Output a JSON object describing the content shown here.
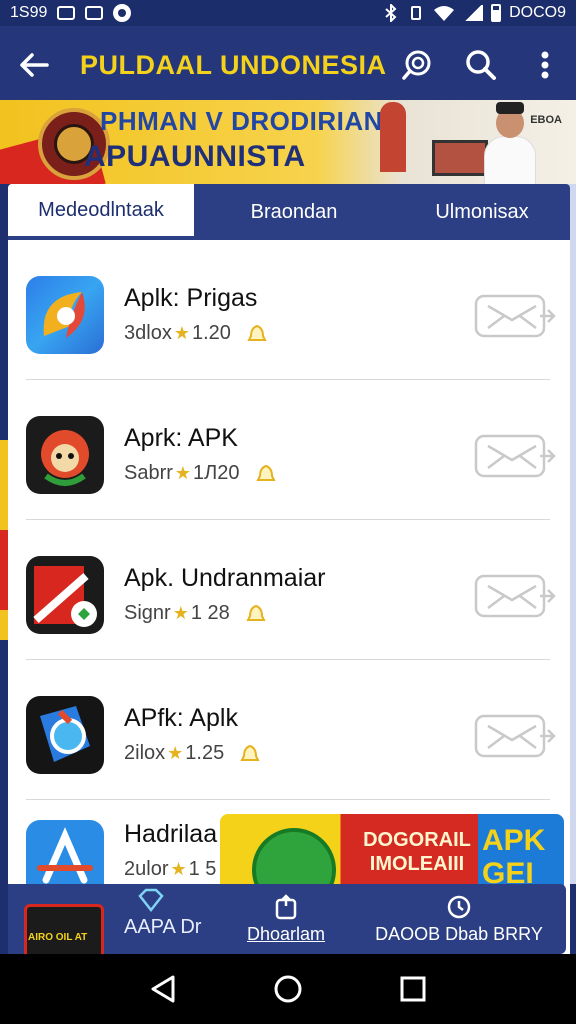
{
  "status_bar": {
    "time": "1S99",
    "clock_right": "DOCO9"
  },
  "app_bar": {
    "title": "PULDAAL UNDONESIA",
    "back_icon": "arrow-left-icon",
    "actions": [
      "chat-search-icon",
      "search-icon",
      "more-vert-icon"
    ]
  },
  "banner": {
    "title": "PHMAN V DRODIRIAN",
    "subtitle": "APUAUNNISTA",
    "corner_text": "EBOA"
  },
  "tabs": [
    {
      "label": "Medeodlntaak",
      "active": true
    },
    {
      "label": "Braondan",
      "active": false
    },
    {
      "label": "Ulmonisax",
      "active": false
    }
  ],
  "apps": [
    {
      "name": "Aplk: Prigas",
      "meta": "3dlox",
      "rating": "1.20"
    },
    {
      "name": "Aprk: APK",
      "meta": "Sabrr",
      "rating": "1Л20"
    },
    {
      "name": "Apk. Undranmaiar",
      "meta": "Signr",
      "rating": "1 28"
    },
    {
      "name": "APfk: Aplk",
      "meta": "2ilox",
      "rating": "1.25"
    },
    {
      "name": "Hadrilaa",
      "meta": "2ulor",
      "rating": "1 5"
    }
  ],
  "ad": {
    "text_main": "DOGORAIL IMOLEAIII",
    "text_apk": "APK GEI"
  },
  "bottom_bar": {
    "label": "AAPA Dr",
    "thumb_text": "AIRO OIL AT"
  },
  "overlay_nav": [
    {
      "label": "Dhoarlam",
      "icon": "upload-icon"
    },
    {
      "label": "DAOOB Dbab BRRY",
      "icon": "clock-icon"
    }
  ],
  "colors": {
    "primary": "#25377a",
    "accent_yellow": "#f4d21c",
    "star": "#e5b320"
  }
}
